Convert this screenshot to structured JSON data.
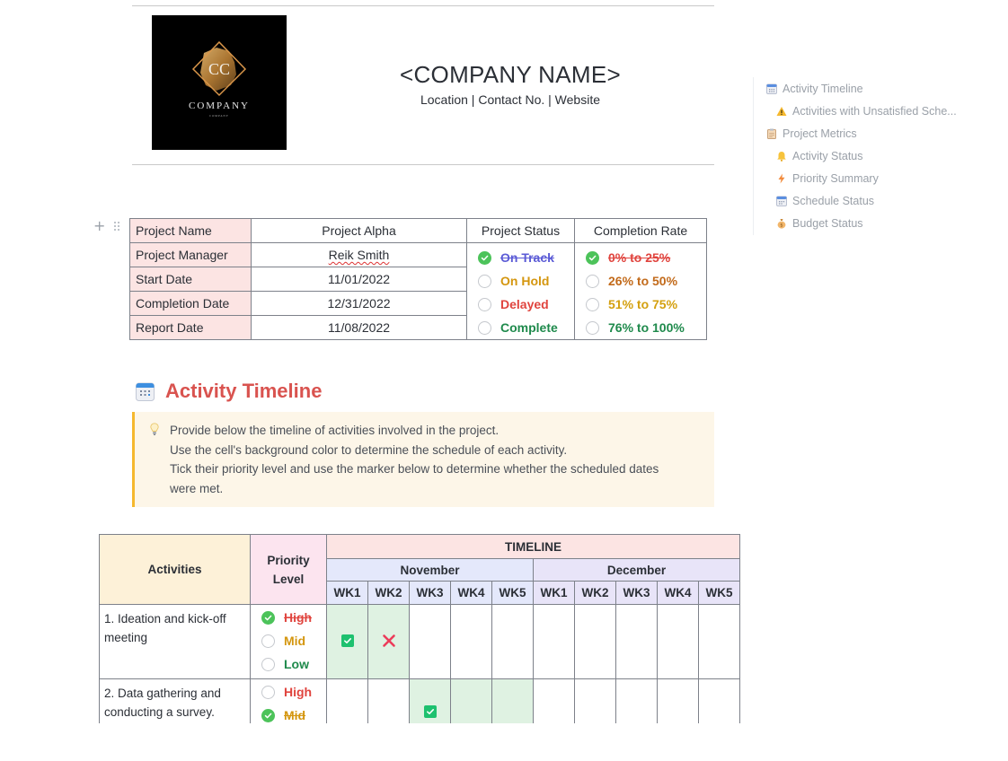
{
  "header": {
    "logo_text": "COMPANY",
    "logo_subtext": "COMPANY",
    "logo_monogram": "CC",
    "company_name": "<COMPANY NAME>",
    "company_details": "Location | Contact No. | Website"
  },
  "outline": {
    "items": [
      {
        "label": "Activity Timeline",
        "icon": "calendar-icon",
        "level": 1
      },
      {
        "label": "Activities with Unsatisfied Sche...",
        "icon": "warning-icon",
        "level": 2
      },
      {
        "label": "Project Metrics",
        "icon": "clipboard-icon",
        "level": 1
      },
      {
        "label": "Activity Status",
        "icon": "bell-icon",
        "level": 2
      },
      {
        "label": "Priority Summary",
        "icon": "lightning-icon",
        "level": 2
      },
      {
        "label": "Schedule Status",
        "icon": "calendar-icon",
        "level": 2
      },
      {
        "label": "Budget Status",
        "icon": "money-bag-icon",
        "level": 2
      }
    ]
  },
  "project_info": {
    "rows": [
      {
        "label": "Project Name",
        "value": "Project Alpha"
      },
      {
        "label": "Project Manager",
        "value": "Reik Smith"
      },
      {
        "label": "Start Date",
        "value": "11/01/2022"
      },
      {
        "label": "Completion Date",
        "value": "12/31/2022"
      },
      {
        "label": "Report Date",
        "value": "11/08/2022"
      }
    ],
    "status_header": "Project Status",
    "status_options": [
      {
        "label": "On Track",
        "checked": true,
        "color": "#5b5bd6"
      },
      {
        "label": "On Hold",
        "checked": false,
        "color": "#d4960f"
      },
      {
        "label": "Delayed",
        "checked": false,
        "color": "#e0443e"
      },
      {
        "label": "Complete",
        "checked": false,
        "color": "#1f8a4c"
      }
    ],
    "rate_header": "Completion Rate",
    "rate_options": [
      {
        "label": "0% to 25%",
        "checked": true,
        "color": "#e0443e"
      },
      {
        "label": "26% to 50%",
        "checked": false,
        "color": "#c26a1a"
      },
      {
        "label": "51% to 75%",
        "checked": false,
        "color": "#d4a00f"
      },
      {
        "label": "76% to 100%",
        "checked": false,
        "color": "#1f8a4c"
      }
    ]
  },
  "activity_timeline": {
    "title": "Activity Timeline",
    "callout_lines": [
      "Provide below the timeline of activities involved in the project.",
      "Use the cell's background color to determine the schedule of each activity.",
      "Tick their priority level and use the marker below to determine whether the scheduled dates",
      "were met."
    ],
    "table": {
      "activities_header": "Activities",
      "priority_header": "Priority Level",
      "timeline_header": "TIMELINE",
      "months": [
        "November",
        "December"
      ],
      "weeks": [
        "WK1",
        "WK2",
        "WK3",
        "WK4",
        "WK5",
        "WK1",
        "WK2",
        "WK3",
        "WK4",
        "WK5"
      ],
      "priority_colors": {
        "High": "#e0443e",
        "Mid": "#d4960f",
        "Low": "#1f8a4c"
      },
      "rows": [
        {
          "activity": "1. Ideation and kick-off meeting",
          "priority": [
            {
              "label": "High",
              "checked": true
            },
            {
              "label": "Mid",
              "checked": false
            },
            {
              "label": "Low",
              "checked": false
            }
          ],
          "scheduled_weeks": [
            0,
            1
          ],
          "markers": {
            "0": "met",
            "1": "not-met"
          }
        },
        {
          "activity": "2. Data gathering and conducting a survey.",
          "priority": [
            {
              "label": "High",
              "checked": false
            },
            {
              "label": "Mid",
              "checked": true
            }
          ],
          "scheduled_weeks": [
            2,
            3,
            4
          ],
          "markers": {
            "2": "met"
          }
        }
      ]
    }
  }
}
